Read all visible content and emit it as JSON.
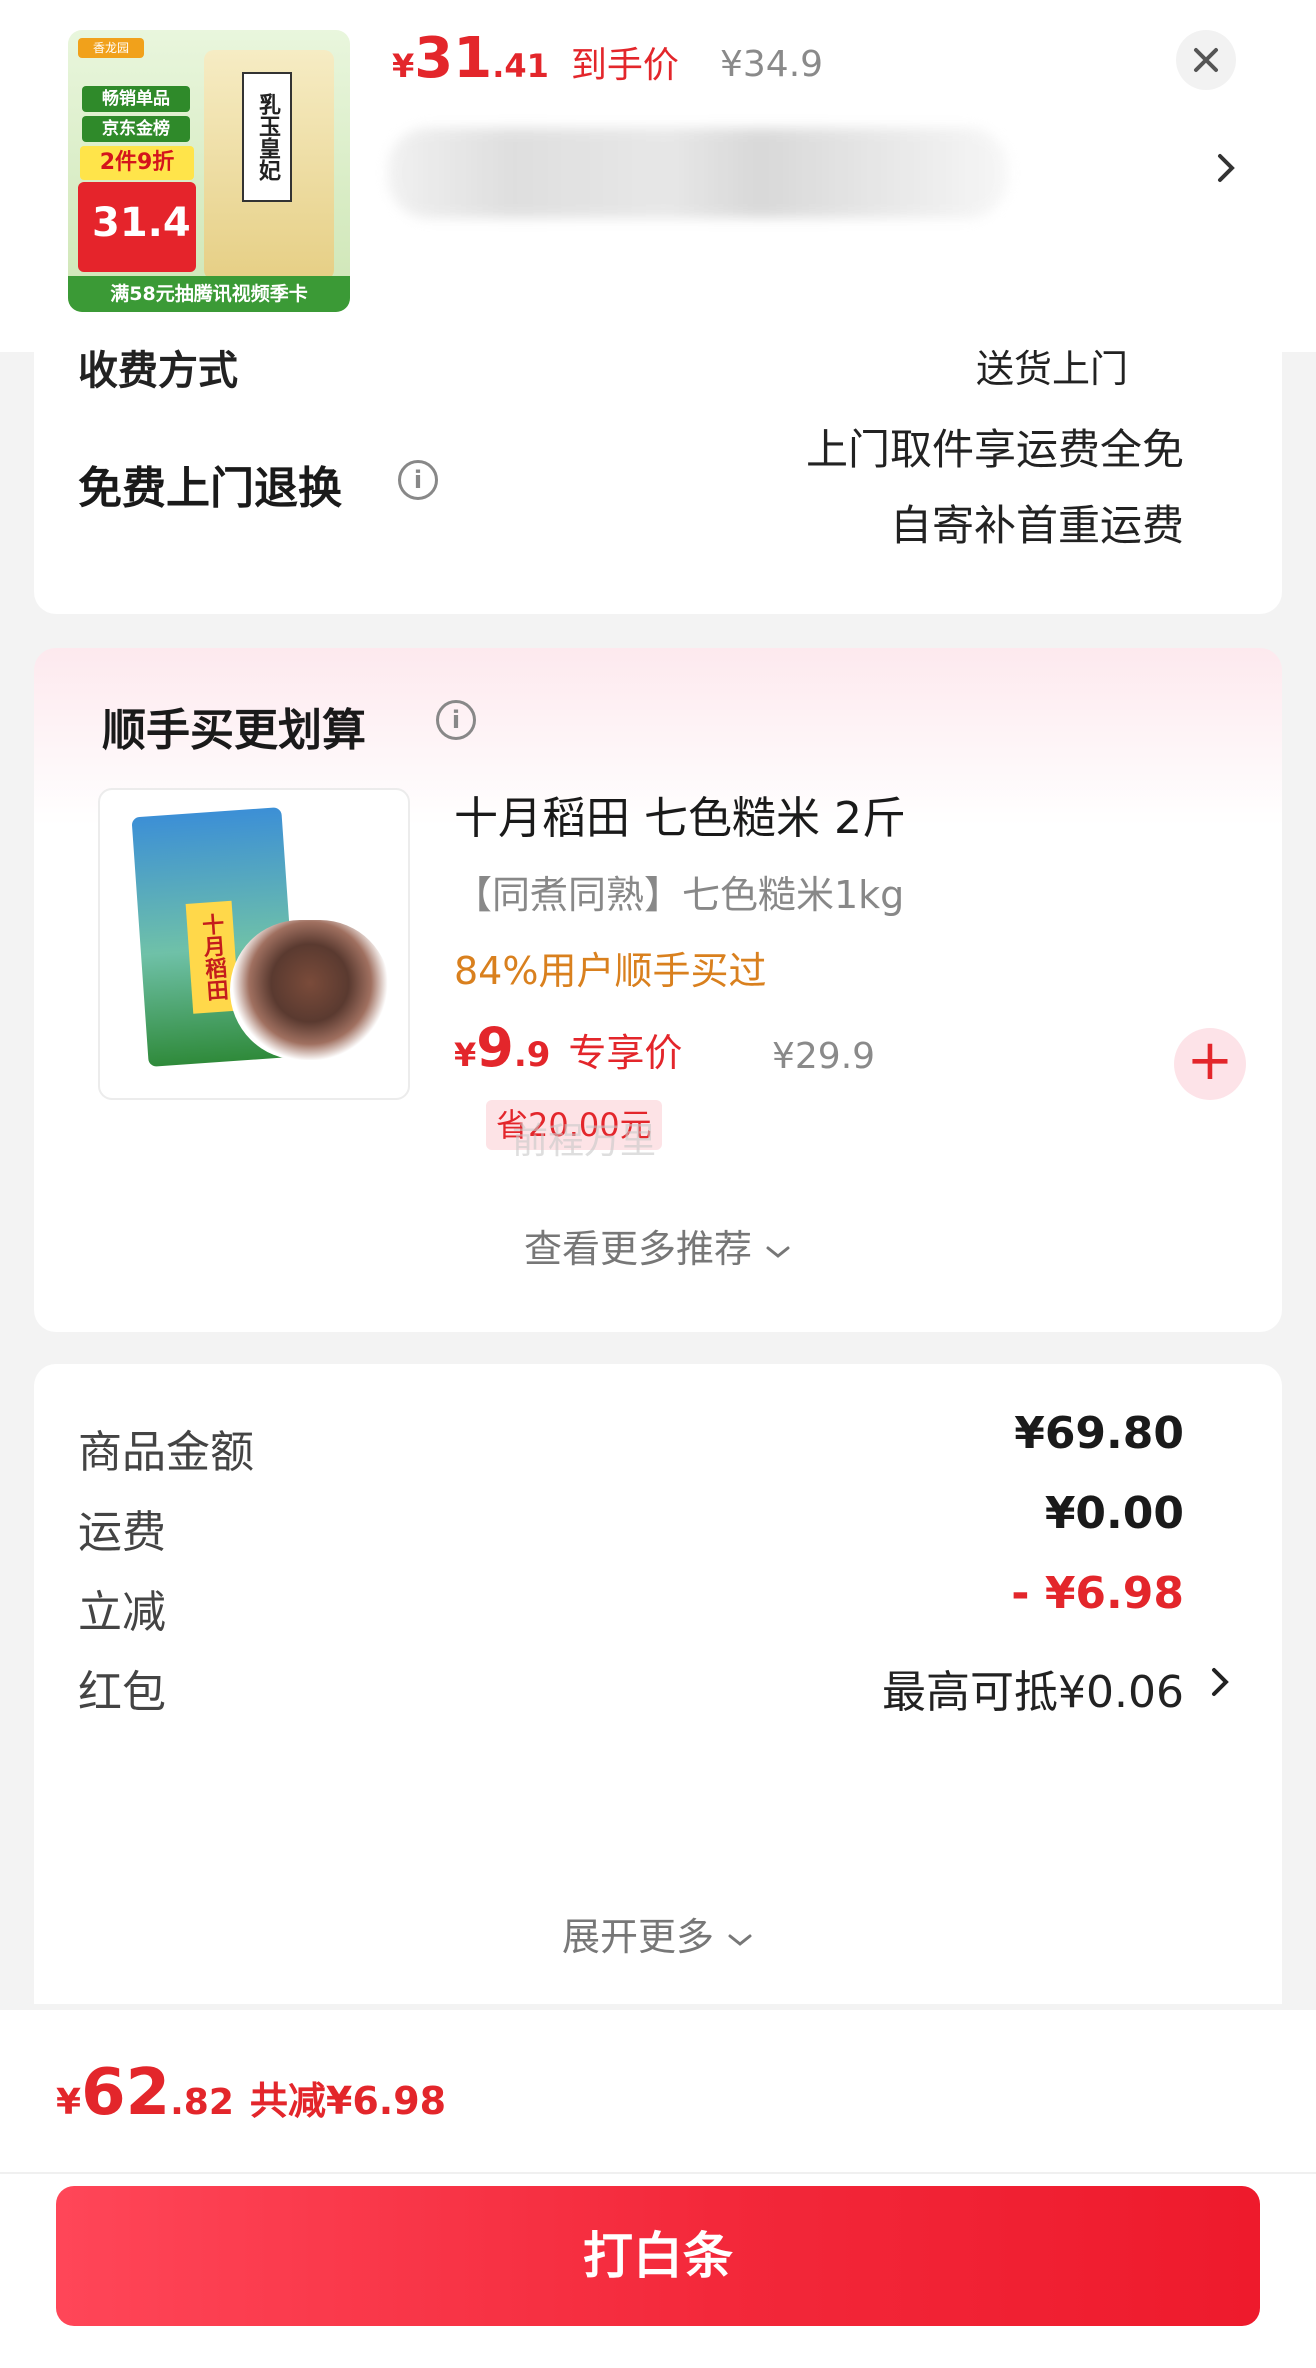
{
  "header": {
    "thumb": {
      "brand": "香龙园",
      "tag_bestseller": "畅销单品",
      "tag_ranking": "京东金榜",
      "tag_discount": "2件9折",
      "thumb_price": "31.4",
      "bag_label": "乳玉皇妃",
      "bottom_banner": "满58元抽腾讯视频季卡"
    },
    "price_symbol": "¥",
    "price_int": "31",
    "price_dec": ".41",
    "price_label": "到手价",
    "original_price": "¥34.9"
  },
  "return_policy": {
    "cut_label": "收费方式",
    "cut_value": "送货上门",
    "title": "免费上门退换",
    "info_icon": "i",
    "line1": "上门取件享运费全免",
    "line2": "自寄补首重运费"
  },
  "recommend": {
    "title": "顺手买更划算",
    "product": {
      "name": "十月稻田 七色糙米 2斤",
      "subtitle": "【同煮同熟】七色糙米1kg",
      "hint": "84%用户顺手买过",
      "price_symbol": "¥",
      "price_int": "9",
      "price_dec": ".9",
      "price_label": "专享价",
      "original_price": "¥29.9",
      "save_tag": "省20.00元",
      "pack_label": "十月稻田"
    },
    "more_label": "查看更多推荐",
    "watermark": "前程万里"
  },
  "amounts": {
    "rows": [
      {
        "label": "商品金额",
        "value": "¥69.80"
      },
      {
        "label": "运费",
        "value": "¥0.00"
      },
      {
        "label": "立减",
        "value": "- ¥6.98"
      },
      {
        "label": "红包",
        "value": "最高可抵¥0.06"
      }
    ],
    "expand_label": "展开更多"
  },
  "footer": {
    "total_symbol": "¥",
    "total_int": "62",
    "total_dec": ".82",
    "discount_label": "共减¥6.98",
    "pay_button": "打白条"
  },
  "colors": {
    "accent_red": "#e3262b",
    "hint_orange": "#d9801e"
  }
}
